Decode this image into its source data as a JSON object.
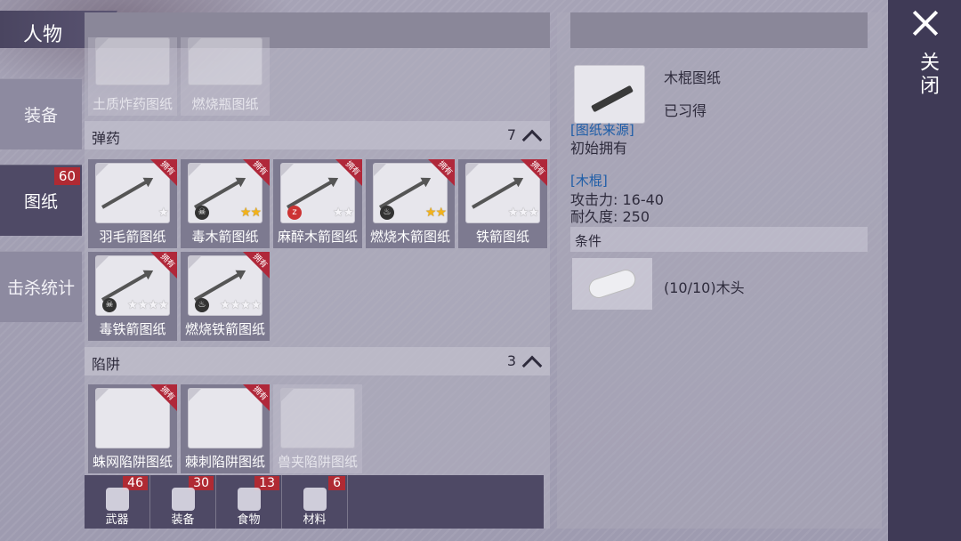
{
  "header": {
    "title": "人物"
  },
  "nav": {
    "tabs": [
      {
        "label": "装备",
        "badge": ""
      },
      {
        "label": "图纸",
        "badge": "60"
      },
      {
        "label": "击杀统计",
        "badge": ""
      }
    ]
  },
  "top_row": {
    "items": [
      {
        "label": "土质炸药图纸"
      },
      {
        "label": "燃烧瓶图纸"
      }
    ]
  },
  "sections": {
    "ammo": {
      "label": "弹药",
      "count": "7"
    },
    "traps": {
      "label": "陷阱",
      "count": "3"
    }
  },
  "ribbon_text": "拥有",
  "ammo_items": [
    {
      "label": "羽毛箭图纸",
      "stars_gold": "",
      "stars_white": "★",
      "effect": ""
    },
    {
      "label": "毒木箭图纸",
      "stars_gold": "★★",
      "stars_white": "",
      "effect": "☠"
    },
    {
      "label": "麻醉木箭图纸",
      "stars_gold": "",
      "stars_white": "★★",
      "effect": "z"
    },
    {
      "label": "燃烧木箭图纸",
      "stars_gold": "★★",
      "stars_white": "",
      "effect": "♨"
    },
    {
      "label": "铁箭图纸",
      "stars_gold": "",
      "stars_white": "★★★",
      "effect": ""
    },
    {
      "label": "毒铁箭图纸",
      "stars_gold": "",
      "stars_white": "★★★★",
      "effect": "☠"
    },
    {
      "label": "燃烧铁箭图纸",
      "stars_gold": "",
      "stars_white": "★★★★",
      "effect": "♨"
    }
  ],
  "trap_items": [
    {
      "label": "蛛网陷阱图纸"
    },
    {
      "label": "棘刺陷阱图纸"
    },
    {
      "label": "兽夹陷阱图纸"
    }
  ],
  "categories": [
    {
      "label": "武器",
      "badge": "46"
    },
    {
      "label": "装备",
      "badge": "30"
    },
    {
      "label": "食物",
      "badge": "13"
    },
    {
      "label": "材料",
      "badge": "6"
    }
  ],
  "detail": {
    "name": "木棍图纸",
    "status": "已习得",
    "source_title": "[图纸来源]",
    "source_value": "初始拥有",
    "item_title": "[木棍]",
    "attack": "攻击力: 16-40",
    "durability": "耐久度: 250",
    "condition_label": "条件",
    "material": "(10/10)木头"
  },
  "close": {
    "label": "关闭"
  },
  "colors": {
    "accent_dark": "#4e4965",
    "badge_red": "#b02a33",
    "link_blue": "#1f5ea8",
    "star_gold": "#f2b21c"
  }
}
